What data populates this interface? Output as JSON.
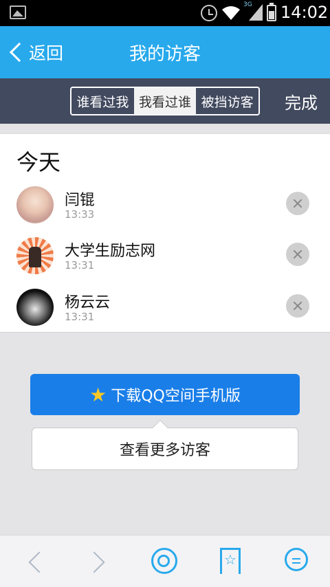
{
  "status_bar": {
    "time": "14:02",
    "network_label": "3G",
    "icons": [
      "gallery-icon",
      "alarm-icon",
      "wifi-icon",
      "signal-icon",
      "battery-icon"
    ]
  },
  "header": {
    "back_label": "返回",
    "title": "我的访客"
  },
  "tabs": {
    "items": [
      {
        "label": "谁看过我",
        "active": false
      },
      {
        "label": "我看过谁",
        "active": true
      },
      {
        "label": "被挡访客",
        "active": false
      }
    ],
    "done_label": "完成"
  },
  "list": {
    "section_title": "今天",
    "visitors": [
      {
        "name": "闫锟",
        "time": "13:33"
      },
      {
        "name": "大学生励志网",
        "time": "13:31"
      },
      {
        "name": "杨云云",
        "time": "13:31"
      }
    ]
  },
  "actions": {
    "download_label": "下载QQ空间手机版",
    "more_label": "查看更多访客"
  },
  "toolbar": {
    "icons": [
      "back-arrow-icon",
      "forward-arrow-icon",
      "qzone-icon",
      "favorite-icon",
      "menu-icon"
    ]
  },
  "colors": {
    "accent": "#28a9ec",
    "segment_bar": "#424a5f",
    "download_button": "#1a7ee8"
  }
}
